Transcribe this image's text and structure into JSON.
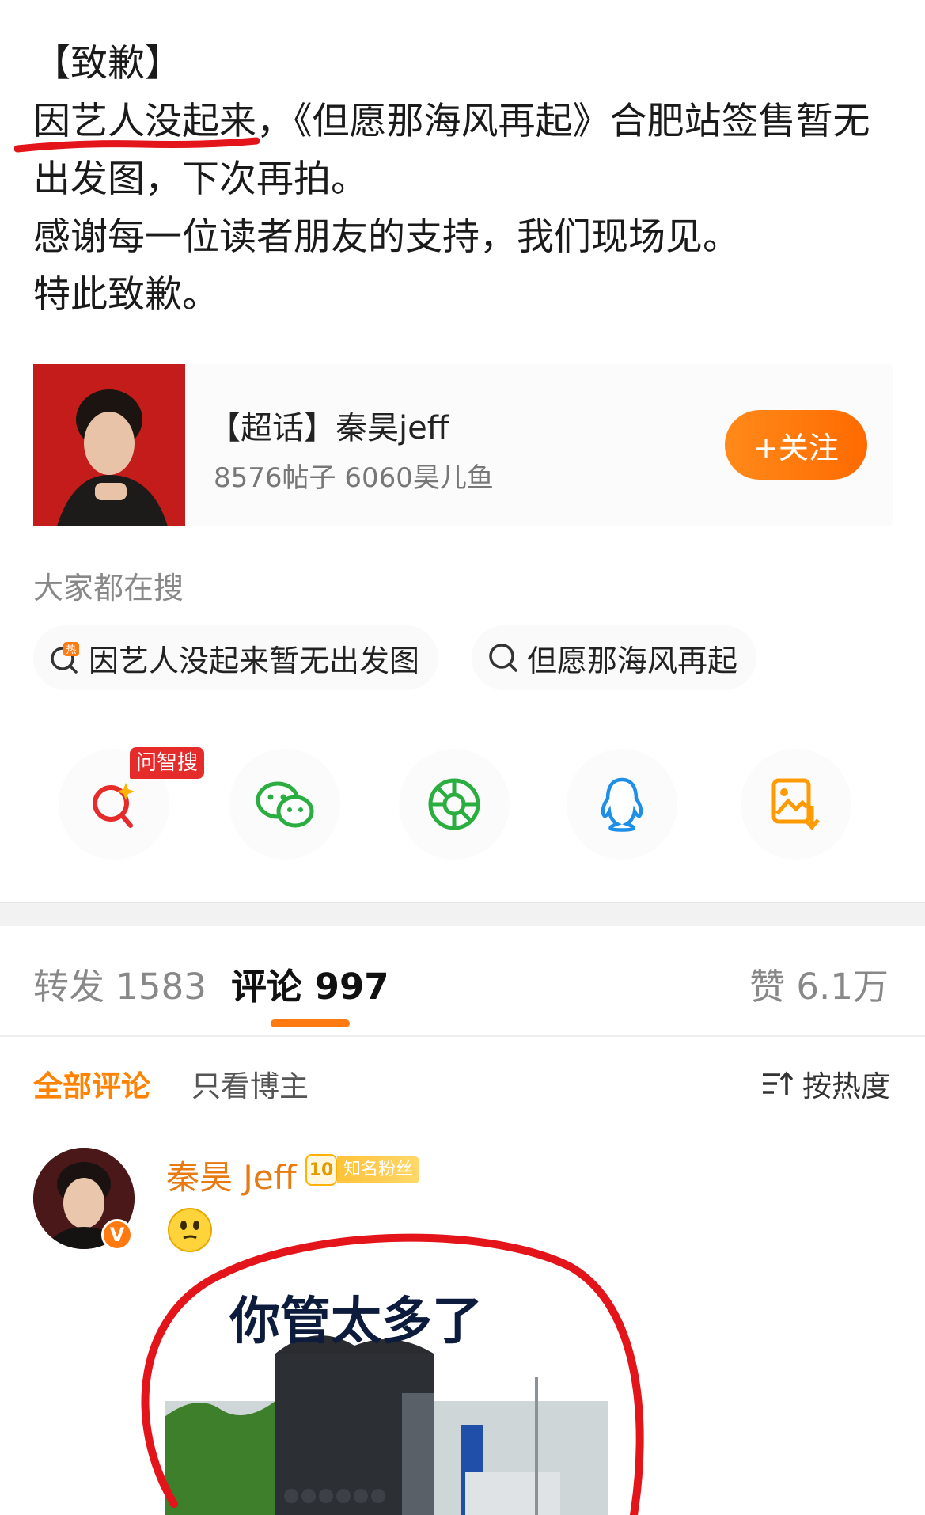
{
  "post": {
    "lines": [
      "【致歉】",
      "因艺人没起来，《但愿那海风再起》合肥站签售暂无",
      "出发图，下次再拍。",
      "感谢每一位读者朋友的支持，我们现场见。",
      "特此致歉。"
    ]
  },
  "supertopic": {
    "title": "【超话】秦昊jeff",
    "stats": "8576帖子 6060昊儿鱼",
    "follow_label": "+关注"
  },
  "search": {
    "label": "大家都在搜",
    "chips": [
      "因艺人没起来暂无出发图",
      "但愿那海风再起"
    ]
  },
  "share": {
    "ai_badge": "问智搜",
    "icons": [
      "ai-search-icon",
      "wechat-icon",
      "moments-icon",
      "qq-icon",
      "save-image-icon"
    ]
  },
  "tabs": {
    "repost": "转发 1583",
    "comments": "评论 997",
    "likes": "赞 6.1万"
  },
  "filters": {
    "all": "全部评论",
    "author_only": "只看博主",
    "sort": "按热度"
  },
  "comment": {
    "name": "秦昊 Jeff",
    "fan_level": "10",
    "fan_label": "知名粉丝",
    "verified": "V",
    "meme_caption": "你管太多了"
  },
  "colors": {
    "accent": "#ff8200",
    "follow_btn": "#ff7a10",
    "badge_red": "#e62b2b",
    "mark_red": "#e3141a"
  }
}
